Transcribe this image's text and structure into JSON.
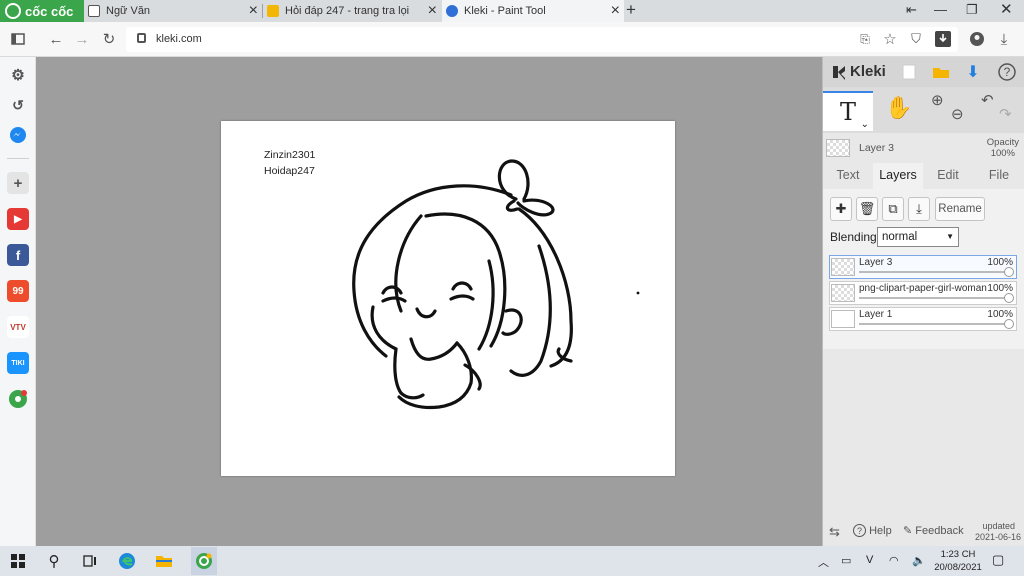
{
  "browser": {
    "brand": "cốc cốc",
    "tabs": [
      {
        "label": "Ngữ Văn"
      },
      {
        "label": "Hỏi đáp 247 - trang tra lọi"
      },
      {
        "label": "Kleki - Paint Tool"
      }
    ],
    "url": "kleki.com"
  },
  "canvas": {
    "text_line1": "Zinzin2301",
    "text_line2": "Hoidap247"
  },
  "kleki": {
    "logo": "Kleki",
    "active_tool": "T",
    "current_layer": "Layer 3",
    "opacity_label": "Opacity",
    "opacity_value": "100%",
    "tabs": [
      "Text",
      "Layers",
      "Edit",
      "File"
    ],
    "active_tab": "Layers",
    "rename_label": "Rename",
    "blending_label": "Blending",
    "blending_value": "normal",
    "layers": [
      {
        "name": "Layer 3",
        "opacity": "100%",
        "selected": true
      },
      {
        "name": "png-clipart-paper-girl-woman-",
        "opacity": "100%",
        "selected": false
      },
      {
        "name": "Layer 1",
        "opacity": "100%",
        "selected": false
      }
    ],
    "footer": {
      "help": "Help",
      "feedback": "Feedback",
      "updated_label": "updated",
      "updated_date": "2021-06-16"
    }
  },
  "taskbar": {
    "time": "1:23 CH",
    "date": "20/08/2021"
  },
  "colors": {
    "accent": "#3a84e8",
    "brand_green": "#3aa54a"
  }
}
